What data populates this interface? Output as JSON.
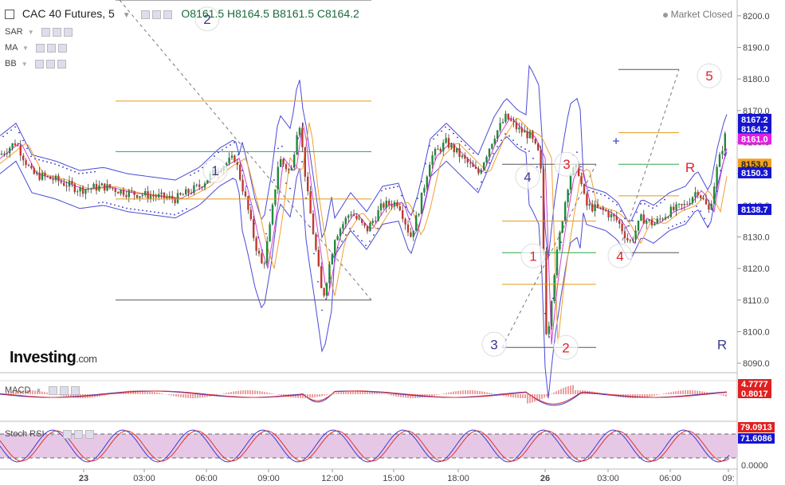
{
  "header": {
    "symbol_label": "CAC 40 Futures, 5",
    "ohlc": "O8161.5  H8164.5  B8161.5  C8164.2",
    "market_status": "Market Closed"
  },
  "indicators": {
    "sar": "SAR",
    "ma": "MA",
    "bb": "BB",
    "macd": "MACD",
    "stoch": "Stoch RSI"
  },
  "logo": {
    "name": "Investing",
    "suffix": ".com"
  },
  "colors": {
    "candle_up": "#1f8a3a",
    "candle_down": "#c0392b",
    "bollinger": "#4a4ad8",
    "sar": "#3030c0",
    "ma": "#f0a030",
    "fib_orange": "#e89a1a",
    "fib_green": "#2aa84a",
    "stoch_bg": "#e6c8e6",
    "wave_red": "#e0232a",
    "wave_blue": "#3a3a8c"
  },
  "chart_data": {
    "type": "candlestick",
    "y_axis": {
      "ticks": [
        "8200.0",
        "8190.0",
        "8180.0",
        "8170.0",
        "8160.0",
        "8150.0",
        "8140.0",
        "8130.0",
        "8120.0",
        "8110.0",
        "8100.0",
        "8090.0"
      ],
      "ylim": [
        8087,
        8205
      ]
    },
    "x_axis": {
      "ticks": [
        "23",
        "03:00",
        "06:00",
        "09:00",
        "12:00",
        "15:00",
        "18:00",
        "26",
        "03:00",
        "06:00",
        "09:"
      ]
    },
    "price_tags": [
      {
        "label": "8167.2",
        "value": 8167.2,
        "color": "#1515d0",
        "text": "#ffffff"
      },
      {
        "label": "8164.2",
        "value": 8164.2,
        "color": "#1515d0",
        "text": "#ffffff"
      },
      {
        "label": "8161.0",
        "value": 8161.0,
        "color": "#e020e0",
        "text": "#ffffff"
      },
      {
        "label": "8153.0",
        "value": 8153.0,
        "color": "#f0a020",
        "text": "#222222"
      },
      {
        "label": "8150.3",
        "value": 8150.3,
        "color": "#1515d0",
        "text": "#ffffff"
      },
      {
        "label": "8138.7",
        "value": 8138.7,
        "color": "#1515d0",
        "text": "#ffffff"
      }
    ],
    "price_path": [
      [
        0,
        8156
      ],
      [
        20,
        8160
      ],
      [
        40,
        8150
      ],
      [
        70,
        8148
      ],
      [
        100,
        8145
      ],
      [
        130,
        8146
      ],
      [
        160,
        8144
      ],
      [
        190,
        8143
      ],
      [
        220,
        8142
      ],
      [
        250,
        8146
      ],
      [
        275,
        8152
      ],
      [
        295,
        8155
      ],
      [
        310,
        8140
      ],
      [
        320,
        8128
      ],
      [
        330,
        8120
      ],
      [
        340,
        8135
      ],
      [
        350,
        8155
      ],
      [
        365,
        8150
      ],
      [
        375,
        8168
      ],
      [
        385,
        8145
      ],
      [
        395,
        8128
      ],
      [
        405,
        8110
      ],
      [
        420,
        8130
      ],
      [
        440,
        8138
      ],
      [
        460,
        8132
      ],
      [
        480,
        8140
      ],
      [
        500,
        8141
      ],
      [
        515,
        8130
      ],
      [
        525,
        8138
      ],
      [
        540,
        8155
      ],
      [
        560,
        8160
      ],
      [
        580,
        8155
      ],
      [
        600,
        8150
      ],
      [
        620,
        8162
      ],
      [
        635,
        8168
      ],
      [
        650,
        8164
      ],
      [
        665,
        8162
      ],
      [
        678,
        8155
      ],
      [
        686,
        8096
      ],
      [
        695,
        8118
      ],
      [
        705,
        8135
      ],
      [
        715,
        8150
      ],
      [
        725,
        8152
      ],
      [
        735,
        8140
      ],
      [
        760,
        8138
      ],
      [
        775,
        8135
      ],
      [
        790,
        8128
      ],
      [
        805,
        8136
      ],
      [
        820,
        8134
      ],
      [
        840,
        8138
      ],
      [
        860,
        8140
      ],
      [
        875,
        8145
      ],
      [
        890,
        8138
      ],
      [
        900,
        8152
      ],
      [
        910,
        8162
      ],
      [
        915,
        8164
      ]
    ],
    "fib_levels": [
      {
        "value": 8173,
        "x1": 145,
        "x2": 466,
        "color": "#e89a1a"
      },
      {
        "value": 8157,
        "x1": 145,
        "x2": 466,
        "color": "#2aa84a"
      },
      {
        "value": 8142,
        "x1": 145,
        "x2": 466,
        "color": "#e89a1a"
      },
      {
        "value": 8110,
        "x1": 145,
        "x2": 466,
        "color": "#555555"
      },
      {
        "value": 8205,
        "x1": 145,
        "x2": 466,
        "color": "#555555"
      },
      {
        "value": 8153,
        "x1": 630,
        "x2": 748,
        "color": "#555555"
      },
      {
        "value": 8135,
        "x1": 630,
        "x2": 748,
        "color": "#e89a1a"
      },
      {
        "value": 8125,
        "x1": 630,
        "x2": 748,
        "color": "#2aa84a"
      },
      {
        "value": 8115,
        "x1": 630,
        "x2": 748,
        "color": "#e89a1a"
      },
      {
        "value": 8095,
        "x1": 630,
        "x2": 748,
        "color": "#555555"
      },
      {
        "value": 8183,
        "x1": 776,
        "x2": 852,
        "color": "#555555"
      },
      {
        "value": 8163,
        "x1": 776,
        "x2": 852,
        "color": "#e89a1a"
      },
      {
        "value": 8153,
        "x1": 776,
        "x2": 852,
        "color": "#2aa84a"
      },
      {
        "value": 8143,
        "x1": 776,
        "x2": 852,
        "color": "#e89a1a"
      },
      {
        "value": 8125,
        "x1": 776,
        "x2": 852,
        "color": "#555555"
      }
    ],
    "wave_labels": [
      {
        "label": "2",
        "x": 260,
        "value": 8199,
        "color": "#3a3a8c",
        "ring": true
      },
      {
        "label": "1",
        "x": 270,
        "value": 8151,
        "color": "#3a3a8c",
        "ring": true
      },
      {
        "label": "4",
        "x": 662,
        "value": 8149,
        "color": "#3a3a8c",
        "ring": true
      },
      {
        "label": "3",
        "x": 711,
        "value": 8153,
        "color": "#e0232a",
        "ring": true
      },
      {
        "label": "1",
        "x": 669,
        "value": 8124,
        "color": "#e0232a",
        "ring": true
      },
      {
        "label": "4",
        "x": 778,
        "value": 8124,
        "color": "#e0232a",
        "ring": true
      },
      {
        "label": "3",
        "x": 620,
        "value": 8096,
        "color": "#3a3a8c",
        "ring": true
      },
      {
        "label": "2",
        "x": 710,
        "value": 8095,
        "color": "#e0232a",
        "ring": true
      },
      {
        "label": "5",
        "x": 890,
        "value": 8181,
        "color": "#e0232a",
        "ring": true
      },
      {
        "label": "R",
        "x": 866,
        "value": 8152,
        "color": "#e0232a",
        "ring": false
      },
      {
        "label": "R",
        "x": 906,
        "value": 8096,
        "color": "#3a3a8c",
        "ring": false
      }
    ]
  },
  "macd_panel": {
    "label": "MACD",
    "tags": [
      {
        "label": "4.7777",
        "color": "#e02020",
        "text": "#ffffff"
      },
      {
        "label": "0.8017",
        "color": "#e02020",
        "text": "#ffffff"
      }
    ]
  },
  "stoch_panel": {
    "label": "Stoch RSI",
    "ticks": [
      "0.0000"
    ],
    "tags": [
      {
        "label": "79.0913",
        "color": "#e02020",
        "text": "#ffffff"
      },
      {
        "label": "71.6086",
        "color": "#1515d0",
        "text": "#ffffff"
      }
    ]
  }
}
